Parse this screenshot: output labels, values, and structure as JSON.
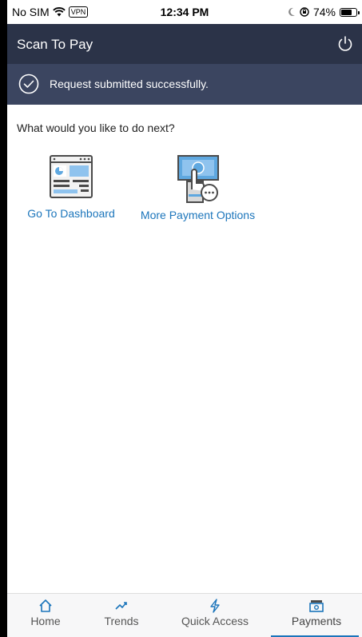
{
  "status_bar": {
    "carrier": "No SIM",
    "vpn": "VPN",
    "time": "12:34 PM",
    "battery": "74%",
    "battery_level": 0.74
  },
  "header": {
    "title": "Scan To Pay",
    "power_icon": "power-icon"
  },
  "banner": {
    "message": "Request submitted successfully.",
    "icon": "check-circle-icon"
  },
  "content": {
    "prompt": "What would you like to do next?",
    "options": [
      {
        "label": "Go To Dashboard",
        "icon": "dashboard-icon"
      },
      {
        "label": "More Payment Options",
        "icon": "payment-options-icon"
      }
    ]
  },
  "tabs": [
    {
      "label": "Home",
      "icon": "home-icon"
    },
    {
      "label": "Trends",
      "icon": "trends-icon"
    },
    {
      "label": "Quick Access",
      "icon": "lightning-icon"
    },
    {
      "label": "Payments",
      "icon": "payments-icon",
      "active": true
    }
  ],
  "colors": {
    "header_bg": "#2b3348",
    "banner_bg": "#3b4560",
    "link": "#1b75bb",
    "tab_active": "#1b75bb"
  }
}
